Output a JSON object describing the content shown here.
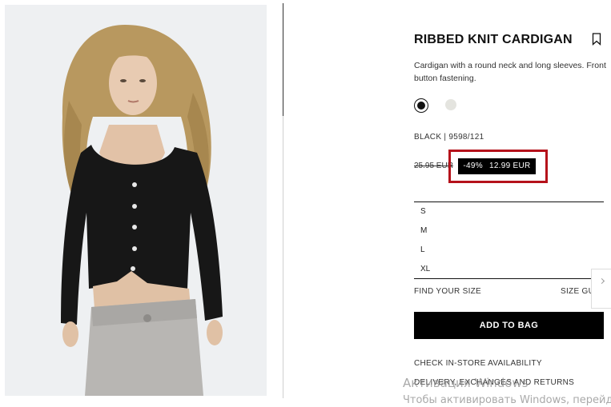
{
  "product": {
    "title": "RIBBED KNIT CARDIGAN",
    "description": "Cardigan with a round neck and long sleeves. Front button fastening.",
    "colors": [
      {
        "name": "black",
        "hex": "#111111",
        "selected": true
      },
      {
        "name": "white",
        "hex": "#e4e4df",
        "selected": false
      }
    ],
    "color_ref": "BLACK | 9598/121",
    "old_price": "25.95 EUR",
    "discount": "-49%",
    "price": "12.99 EUR"
  },
  "sizes": [
    "S",
    "M",
    "L",
    "XL"
  ],
  "find_your_size": "FIND YOUR SIZE",
  "size_guide": "SIZE GUIDE",
  "add_to_bag": "ADD TO BAG",
  "links": {
    "check_store": "CHECK IN-STORE AVAILABILITY",
    "delivery": "DELIVERY, EXCHANGES AND RETURNS"
  },
  "watermark": {
    "line1": "Активация Windows",
    "line2": "Чтобы активировать Windows, перейдите"
  },
  "colors": {
    "highlight": "#b5121b",
    "button": "#000000",
    "photo_bg": "#eef0f2"
  },
  "icons": {
    "bookmark": "bookmark-icon",
    "side_tab": "chevron-icon"
  }
}
